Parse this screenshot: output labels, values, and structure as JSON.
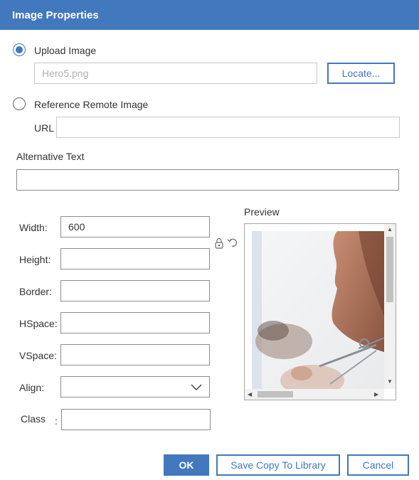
{
  "dialog": {
    "title": "Image Properties"
  },
  "upload": {
    "radio_label": "Upload Image",
    "file_value": "Hero5.png",
    "locate_label": "Locate..."
  },
  "remote": {
    "radio_label": "Reference Remote Image",
    "url_label": "URL",
    "url_value": ""
  },
  "alt_text": {
    "label": "Alternative Text",
    "value": ""
  },
  "fields": {
    "width_label": "Width:",
    "width_value": "600",
    "height_label": "Height:",
    "height_value": "",
    "border_label": "Border:",
    "border_value": "",
    "hspace_label": "HSpace:",
    "hspace_value": "",
    "vspace_label": "VSpace:",
    "vspace_value": "",
    "align_label": "Align:",
    "align_value": "",
    "class_label": "Class",
    "class_colon": ":",
    "class_value": ""
  },
  "preview": {
    "label": "Preview"
  },
  "buttons": {
    "ok": "OK",
    "save_copy": "Save Copy To Library",
    "cancel": "Cancel"
  },
  "icons": {
    "lock": "link-lock-icon",
    "reset": "reset-size-icon",
    "align_dropdown": "chevron-down-icon"
  },
  "colors": {
    "accent": "#4178be",
    "title_text": "#ffffff"
  }
}
